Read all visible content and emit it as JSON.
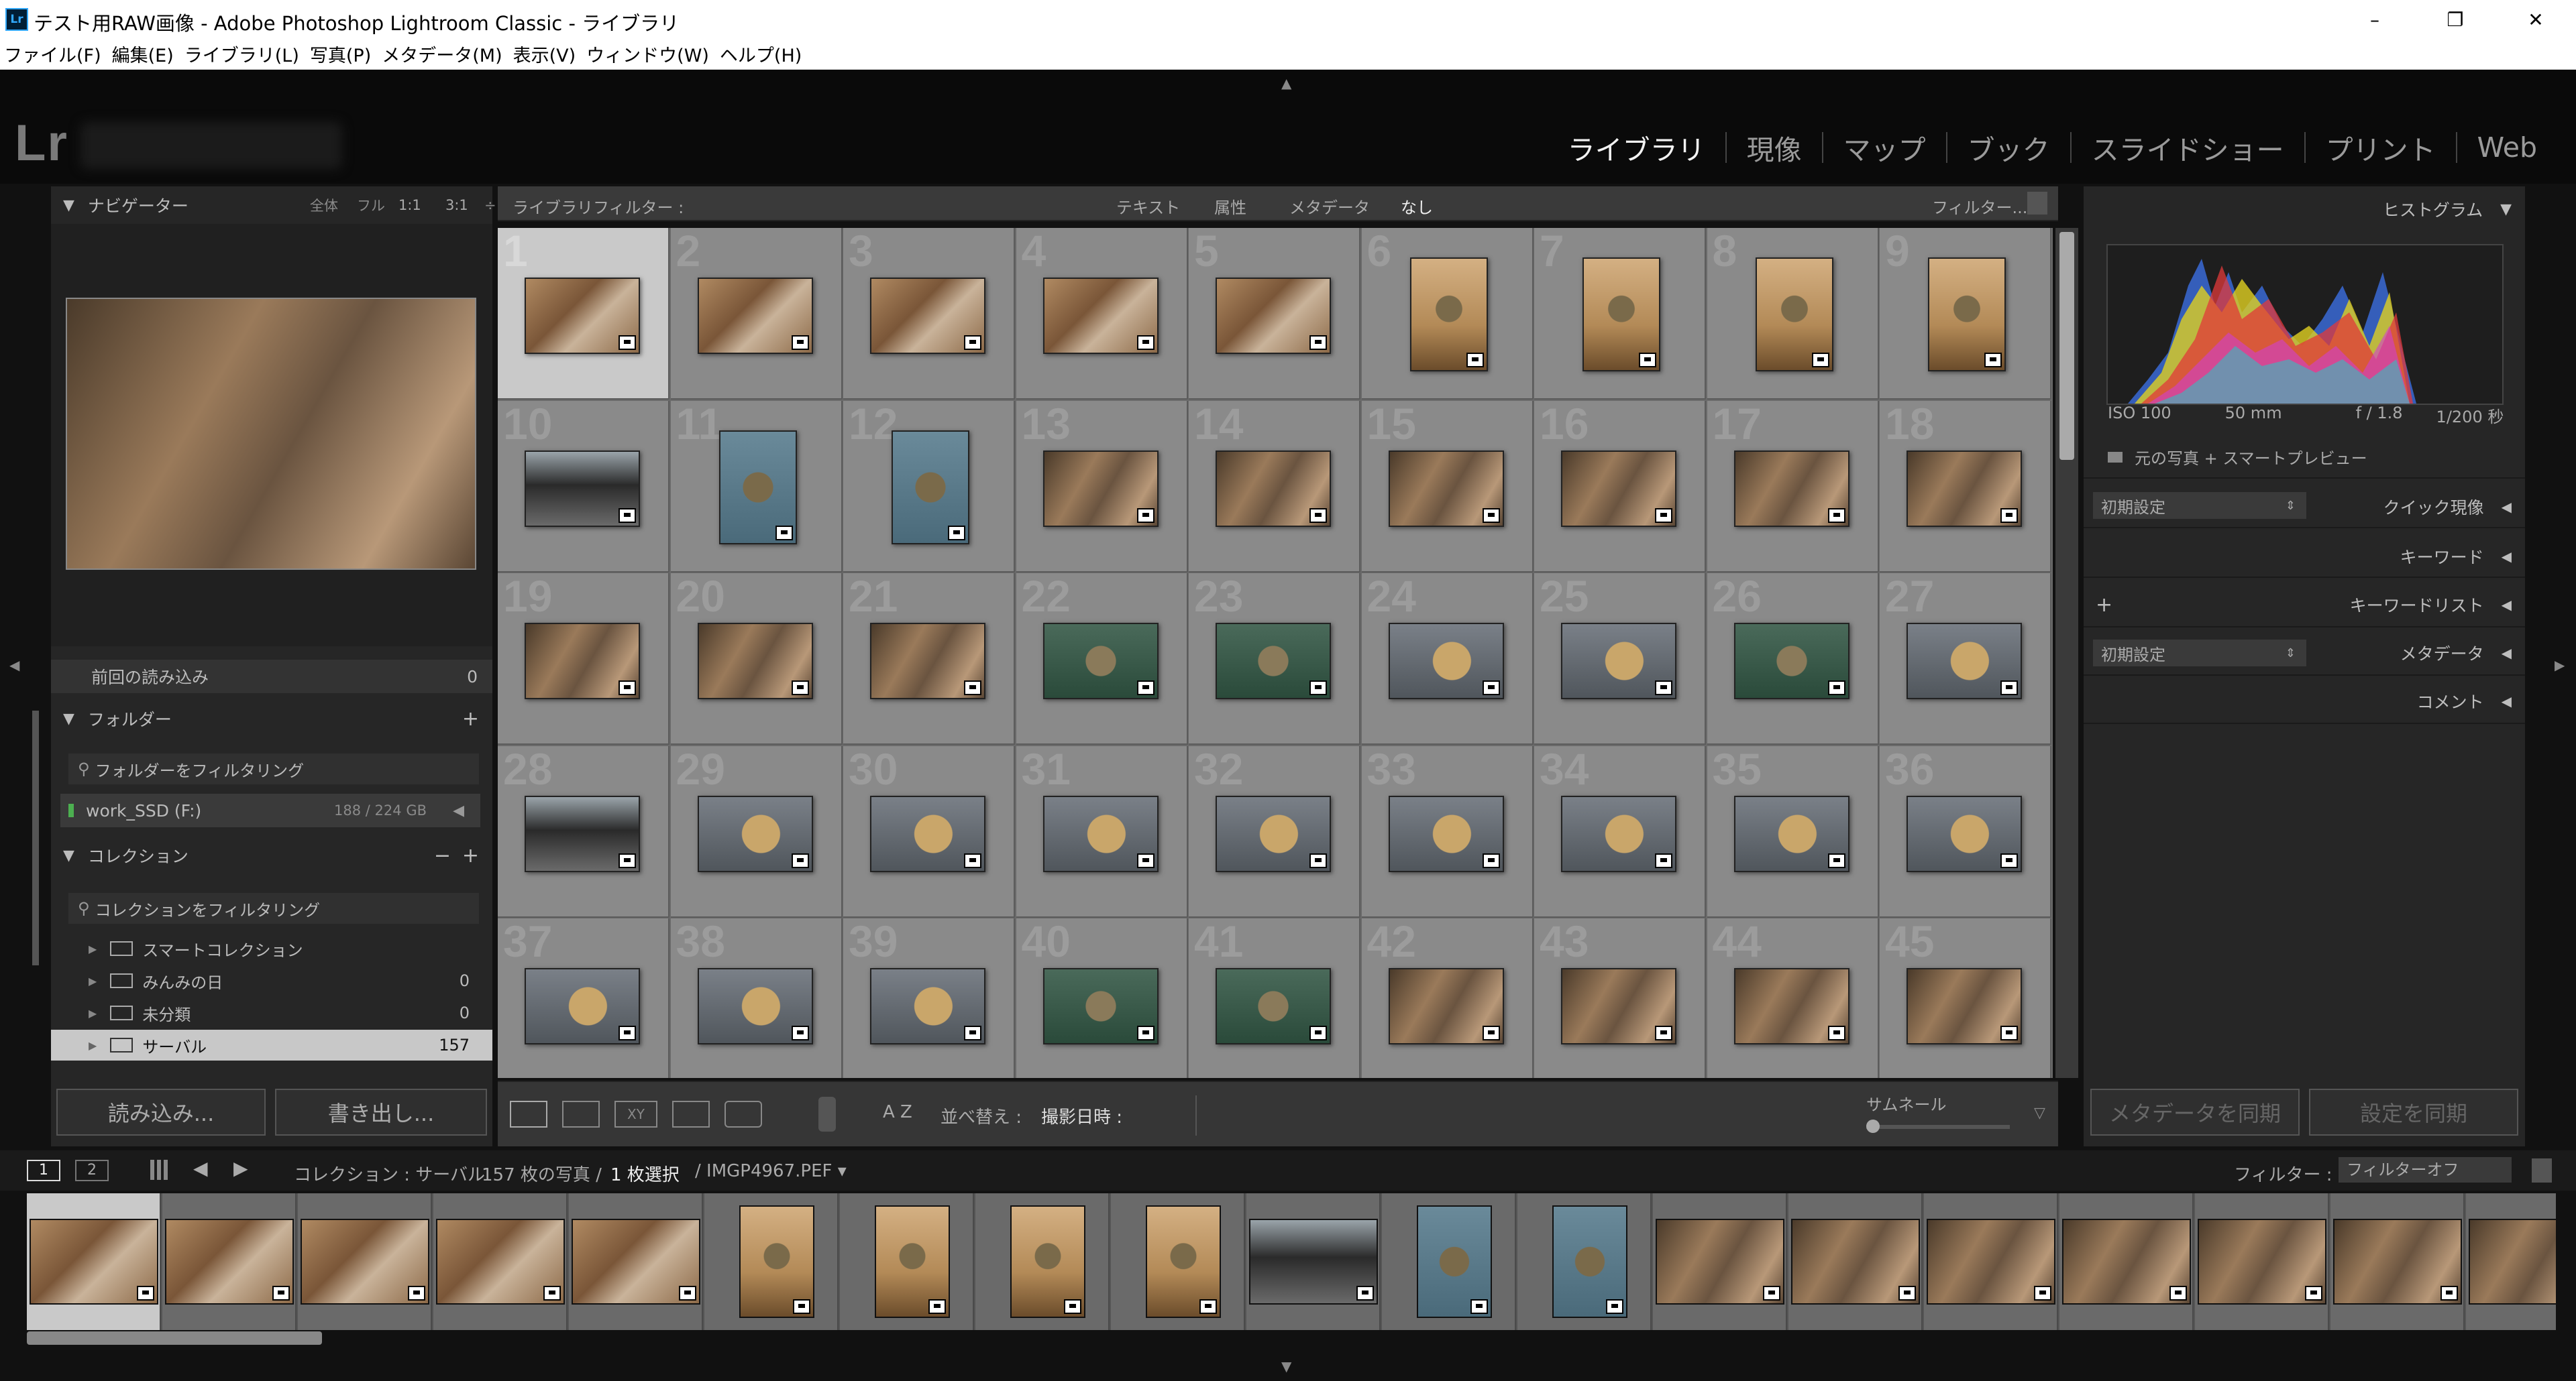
{
  "window": {
    "title": "テスト用RAW画像 - Adobe Photoshop Lightroom Classic - ライブラリ",
    "app_badge": "Lr",
    "controls": {
      "minimize": "–",
      "maximize": "❐",
      "close": "✕"
    }
  },
  "menu": [
    "ファイル(F)",
    "編集(E)",
    "ライブラリ(L)",
    "写真(P)",
    "メタデータ(M)",
    "表示(V)",
    "ウィンドウ(W)",
    "ヘルプ(H)"
  ],
  "identity": {
    "logo": "Lr"
  },
  "modules": [
    {
      "label": "ライブラリ",
      "active": true
    },
    {
      "label": "現像",
      "active": false
    },
    {
      "label": "マップ",
      "active": false
    },
    {
      "label": "ブック",
      "active": false
    },
    {
      "label": "スライドショー",
      "active": false
    },
    {
      "label": "プリント",
      "active": false
    },
    {
      "label": "Web",
      "active": false
    }
  ],
  "left_panel": {
    "navigator": {
      "title": "ナビゲーター",
      "zoom": [
        "全体",
        "フル",
        "1:1",
        "3:1"
      ],
      "zoom_more": "÷"
    },
    "catalog": {
      "item": "前回の読み込み",
      "count": "0"
    },
    "folders": {
      "title": "フォルダー",
      "add": "+",
      "filter": "フォルダーをフィルタリング",
      "volume": "work_SSD (F:)",
      "volume_size": "188 / 224 GB"
    },
    "collections": {
      "title": "コレクション",
      "minus": "−",
      "add": "+",
      "filter": "コレクションをフィルタリング",
      "items": [
        {
          "label": "スマートコレクション",
          "count": ""
        },
        {
          "label": "みんみの日",
          "count": "0"
        },
        {
          "label": "未分類",
          "count": "0"
        },
        {
          "label": "サーバル",
          "count": "157",
          "selected": true
        }
      ]
    },
    "import_button": "読み込み...",
    "export_button": "書き出し..."
  },
  "filter_bar": {
    "label": "ライブラリフィルター :",
    "tabs": [
      "テキスト",
      "属性",
      "メタデータ",
      "なし"
    ],
    "active_tab": "なし",
    "preset": "フィルター..."
  },
  "grid": {
    "cells": [
      {
        "n": "1",
        "o": "land",
        "img": "img-warm",
        "sel": true
      },
      {
        "n": "2",
        "o": "land",
        "img": "img-warm"
      },
      {
        "n": "3",
        "o": "land",
        "img": "img-warm"
      },
      {
        "n": "4",
        "o": "land",
        "img": "img-warm"
      },
      {
        "n": "5",
        "o": "land",
        "img": "img-warm"
      },
      {
        "n": "6",
        "o": "port",
        "img": "img-cat"
      },
      {
        "n": "7",
        "o": "port",
        "img": "img-cat"
      },
      {
        "n": "8",
        "o": "port",
        "img": "img-cat"
      },
      {
        "n": "9",
        "o": "port",
        "img": "img-cat"
      },
      {
        "n": "10",
        "o": "land",
        "img": "img-dark"
      },
      {
        "n": "11",
        "o": "port",
        "img": "img-blue"
      },
      {
        "n": "12",
        "o": "port",
        "img": "img-blue"
      },
      {
        "n": "13",
        "o": "land",
        "img": "img-log"
      },
      {
        "n": "14",
        "o": "land",
        "img": "img-log"
      },
      {
        "n": "15",
        "o": "land",
        "img": "img-log"
      },
      {
        "n": "16",
        "o": "land",
        "img": "img-log"
      },
      {
        "n": "17",
        "o": "land",
        "img": "img-log"
      },
      {
        "n": "18",
        "o": "land",
        "img": "img-log"
      },
      {
        "n": "19",
        "o": "land",
        "img": "img-log"
      },
      {
        "n": "20",
        "o": "land",
        "img": "img-log"
      },
      {
        "n": "21",
        "o": "land",
        "img": "img-log"
      },
      {
        "n": "22",
        "o": "land",
        "img": "img-green"
      },
      {
        "n": "23",
        "o": "land",
        "img": "img-green"
      },
      {
        "n": "24",
        "o": "land",
        "img": "img-face"
      },
      {
        "n": "25",
        "o": "land",
        "img": "img-face"
      },
      {
        "n": "26",
        "o": "land",
        "img": "img-green"
      },
      {
        "n": "27",
        "o": "land",
        "img": "img-face"
      },
      {
        "n": "28",
        "o": "land",
        "img": "img-dark"
      },
      {
        "n": "29",
        "o": "land",
        "img": "img-face"
      },
      {
        "n": "30",
        "o": "land",
        "img": "img-face"
      },
      {
        "n": "31",
        "o": "land",
        "img": "img-face"
      },
      {
        "n": "32",
        "o": "land",
        "img": "img-face"
      },
      {
        "n": "33",
        "o": "land",
        "img": "img-face"
      },
      {
        "n": "34",
        "o": "land",
        "img": "img-face"
      },
      {
        "n": "35",
        "o": "land",
        "img": "img-face"
      },
      {
        "n": "36",
        "o": "land",
        "img": "img-face"
      },
      {
        "n": "37",
        "o": "land",
        "img": "img-face"
      },
      {
        "n": "38",
        "o": "land",
        "img": "img-face"
      },
      {
        "n": "39",
        "o": "land",
        "img": "img-face"
      },
      {
        "n": "40",
        "o": "land",
        "img": "img-green"
      },
      {
        "n": "41",
        "o": "land",
        "img": "img-green"
      },
      {
        "n": "42",
        "o": "land",
        "img": "img-log"
      },
      {
        "n": "43",
        "o": "land",
        "img": "img-log"
      },
      {
        "n": "44",
        "o": "land",
        "img": "img-log"
      },
      {
        "n": "45",
        "o": "land",
        "img": "img-log"
      }
    ]
  },
  "toolbar": {
    "sort_label": "並べ替え :",
    "sort_value": "撮影日時 :",
    "thumb_label": "サムネール",
    "az": "A Z"
  },
  "right_panel": {
    "histogram": {
      "title": "ヒストグラム",
      "iso": "ISO 100",
      "focal": "50 mm",
      "aperture": "f / 1.8",
      "shutter": "1/200 秒",
      "preview": "元の写真 + スマートプレビュー"
    },
    "quick_develop": {
      "preset": "初期設定",
      "title": "クイック現像"
    },
    "keywords": {
      "title": "キーワード"
    },
    "keyword_list": {
      "add": "+",
      "title": "キーワードリスト"
    },
    "metadata": {
      "preset": "初期設定",
      "title": "メタデータ"
    },
    "comments": {
      "title": "コメント"
    },
    "sync_metadata": "メタデータを同期",
    "sync_settings": "設定を同期"
  },
  "filmstrip_bar": {
    "monitor1": "1",
    "monitor2": "2",
    "source": "コレクション : サーバル",
    "count": "157 枚の写真 /",
    "selected": "1 枚選択",
    "file": "/ IMGP4967.PEF ▾",
    "filter_label": "フィルター :",
    "filter_value": "フィルターオフ"
  },
  "filmstrip": [
    {
      "o": "land",
      "img": "img-warm",
      "sel": true
    },
    {
      "o": "land",
      "img": "img-warm"
    },
    {
      "o": "land",
      "img": "img-warm"
    },
    {
      "o": "land",
      "img": "img-warm"
    },
    {
      "o": "land",
      "img": "img-warm"
    },
    {
      "o": "port",
      "img": "img-cat"
    },
    {
      "o": "port",
      "img": "img-cat"
    },
    {
      "o": "port",
      "img": "img-cat"
    },
    {
      "o": "port",
      "img": "img-cat"
    },
    {
      "o": "land",
      "img": "img-dark"
    },
    {
      "o": "port",
      "img": "img-blue"
    },
    {
      "o": "port",
      "img": "img-blue"
    },
    {
      "o": "land",
      "img": "img-log"
    },
    {
      "o": "land",
      "img": "img-log"
    },
    {
      "o": "land",
      "img": "img-log"
    },
    {
      "o": "land",
      "img": "img-log"
    },
    {
      "o": "land",
      "img": "img-log"
    },
    {
      "o": "land",
      "img": "img-log"
    },
    {
      "o": "land",
      "img": "img-log"
    }
  ]
}
